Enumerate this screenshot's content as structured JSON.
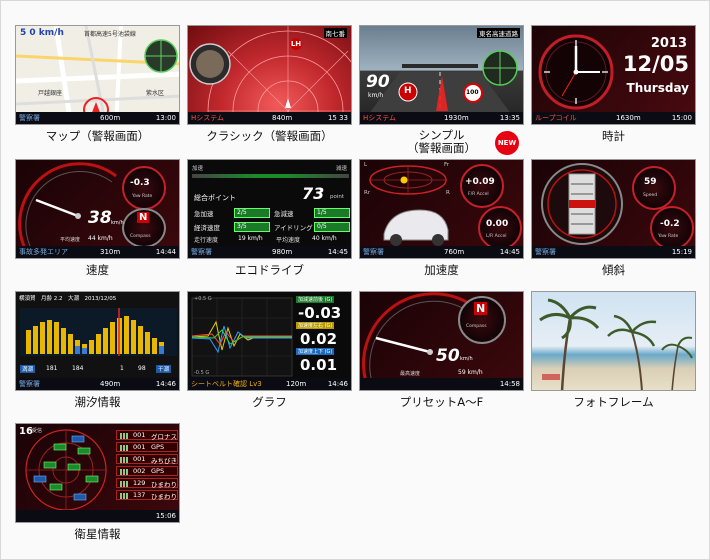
{
  "screens": [
    {
      "caption": "マップ（警報画面）",
      "top": "5 0 km/h",
      "status_left": "警察署",
      "status_mid": "600m",
      "status_right": "13:00",
      "map_label1": "首都高速5号池袋線",
      "map_label2": "戸越銀座",
      "map_label3": "紫水区"
    },
    {
      "caption": "クラシック（警報画面）",
      "top": "南七番",
      "badge": "LH",
      "status_left": "Hシステム",
      "status_mid": "840m",
      "status_right": "15 33"
    },
    {
      "caption_line1": "シンプル",
      "caption_line2": "（警報画面）",
      "new_badge": "NEW",
      "road": "東名高速道路",
      "speed": "90",
      "unit": "km/h",
      "limit": "100",
      "status_left": "Hシステム",
      "status_mid": "1930m",
      "status_right": "13:35"
    },
    {
      "caption": "時計",
      "year": "2013",
      "date": "12/05",
      "weekday": "Thursday",
      "status_left": "ループコイル",
      "status_mid": "1630m",
      "status_right": "15:00"
    },
    {
      "caption": "速度",
      "speed": "38",
      "unit": "km/h",
      "avg_label": "平均速度",
      "avg": "44 km/h",
      "yaw": "-0.3",
      "yaw_label": "Yaw Rate",
      "compass_label": "Compass",
      "compass_dir": "N",
      "status_left": "事故多発エリア",
      "status_mid": "310m",
      "status_right": "14:44"
    },
    {
      "caption": "エコドライブ",
      "title_left": "加速",
      "title_right": "減速",
      "points_label": "総合ポイント",
      "points": "73",
      "points_unit": "point",
      "rows": [
        [
          "急加速",
          "2/5",
          "急減速",
          "1/5"
        ],
        [
          "経済速度",
          "3/5",
          "アイドリング",
          "0/5"
        ]
      ],
      "run_label": "走行速度",
      "run_val": "19 km/h",
      "avg_label": "平均速度",
      "avg_val": "40 km/h",
      "status_left": "警察署",
      "status_mid": "980m",
      "status_right": "14:45"
    },
    {
      "caption": "加速度",
      "fr": "Fr",
      "rr": "Rr",
      "l": "L",
      "r": "R",
      "fr_val": "+0.09",
      "fr_label": "F/R Accel",
      "lr_val": "0.00",
      "lr_label": "L/R Accel",
      "status_left": "警察署",
      "status_mid": "760m",
      "status_right": "14:45"
    },
    {
      "caption": "傾斜",
      "speed": "59",
      "speed_label": "Speed",
      "yaw": "-0.2",
      "yaw_label": "Yaw Rate",
      "status_left": "警察署",
      "status_right": "15:19"
    },
    {
      "caption": "潮汐情報",
      "header": "横須賀　月齢 2.2　大潮　2013/12/05",
      "high_label": "満潮",
      "high1": "181",
      "high2": "184",
      "low_label": "干潮",
      "low1": "1",
      "low2": "98",
      "status_left": "警察署",
      "status_mid": "490m",
      "status_right": "14:46"
    },
    {
      "caption": "グラフ",
      "scale_top": "+0.5 G",
      "scale_bottom": "-0.5 G",
      "l1": "加減速前後 (G)",
      "v1": "-0.03",
      "l2": "加速度左右 (G)",
      "v2": "0.02",
      "l3": "加速度上下 (G)",
      "v3": "0.01",
      "status_left": "シートベルト確認 Lv3",
      "status_mid": "120m",
      "status_right": "14:46"
    },
    {
      "caption": "プリセットA〜F",
      "speed": "50",
      "unit": "km/h",
      "max_label": "最高速度",
      "max_val": "59 km/h",
      "compass_label": "Compass",
      "compass_dir": "N",
      "status_right": "14:58"
    },
    {
      "caption": "フォトフレーム"
    },
    {
      "caption": "衛星情報",
      "count": "16",
      "count_label": "受信",
      "sats": [
        [
          "001",
          "グロナス"
        ],
        [
          "001",
          "GPS"
        ],
        [
          "001",
          "みちびき"
        ],
        [
          "002",
          "GPS"
        ],
        [
          "129",
          "ひまわり"
        ],
        [
          "137",
          "ひまわり"
        ]
      ],
      "status_right": "15:06"
    }
  ]
}
